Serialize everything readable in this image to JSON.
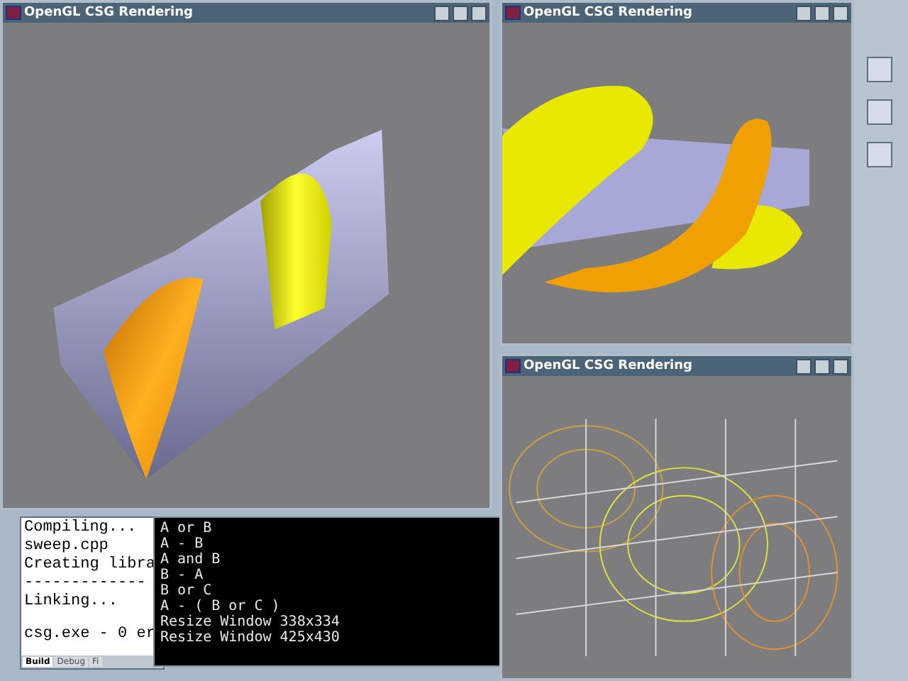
{
  "render_windows": [
    {
      "title": "OpenGL CSG Rendering",
      "kind": "solid-cut"
    },
    {
      "title": "OpenGL CSG Rendering",
      "kind": "solid-helix"
    },
    {
      "title": "OpenGL CSG Rendering",
      "kind": "wireframe"
    }
  ],
  "build_output": {
    "lines": [
      "Compiling...",
      "sweep.cpp",
      "Creating libra",
      "-------------",
      "Linking...",
      "csg.exe - 0 er"
    ],
    "tabs": [
      {
        "label": "Build",
        "selected": true
      },
      {
        "label": "Debug",
        "selected": false
      },
      {
        "label": "Fi",
        "selected": false
      }
    ]
  },
  "console": {
    "lines": [
      "A or B",
      "A - B",
      "A and B",
      "B - A",
      "B or C",
      "A - ( B or C )",
      "Resize Window 338x334",
      "Resize Window 425x430"
    ]
  }
}
